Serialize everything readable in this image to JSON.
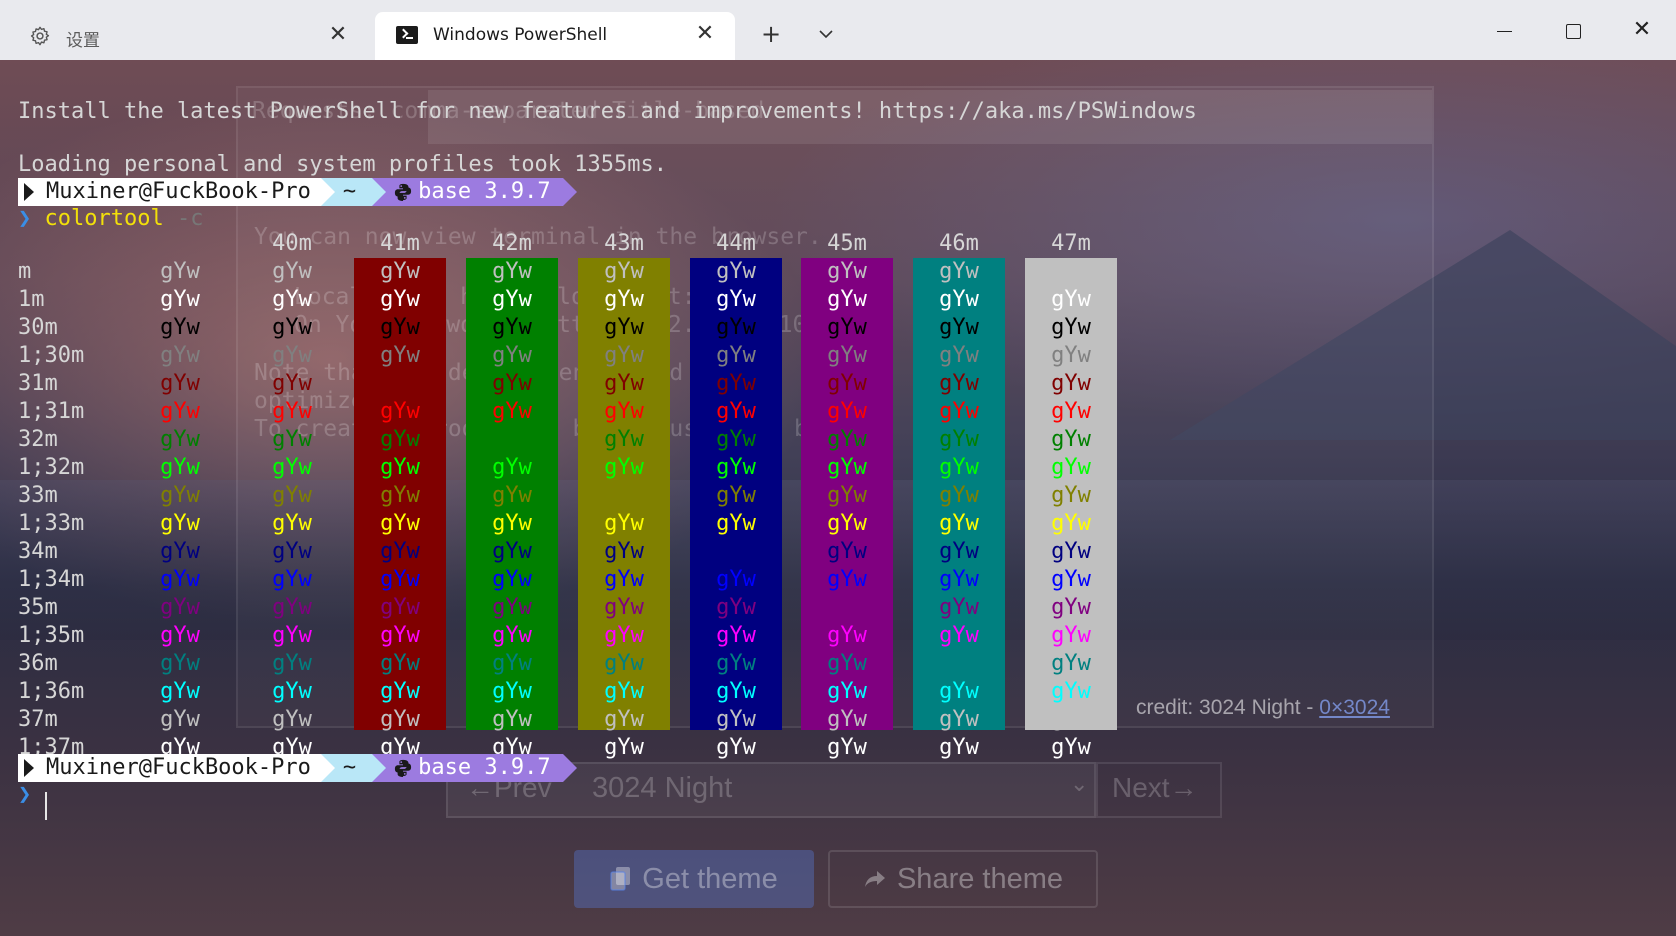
{
  "tabs": [
    {
      "label": "设置",
      "icon": "gear-icon"
    },
    {
      "label": "Windows PowerShell",
      "icon": "powershell-icon"
    }
  ],
  "tabbar": {
    "new_tab": "+",
    "dropdown": "⌄",
    "close": "✕"
  },
  "window": {
    "minimize": "minimize-icon",
    "maximize": "maximize-icon",
    "close": "✕"
  },
  "terminal": {
    "install_line": "Install the latest PowerShell for new features and improvements! https://aka.ms/PSWindows",
    "loading_line": "Loading personal and system profiles took 1355ms.",
    "prompt": {
      "user": "Muxiner@FuckBook-Pro",
      "dir": "~",
      "env": "base 3.9.7"
    },
    "prompt_char": "❯",
    "command": "colortool",
    "command_flag": "-c"
  },
  "colortool": {
    "bg_headers": [
      "40m",
      "41m",
      "42m",
      "43m",
      "44m",
      "45m",
      "46m",
      "47m"
    ],
    "bg_colors": [
      "",
      "#800000",
      "#008000",
      "#808000",
      "#000080",
      "#800080",
      "#008080",
      "#c0c0c0"
    ],
    "sample": "gYw",
    "rows": [
      {
        "label": "m",
        "color": "#c0c0c0"
      },
      {
        "label": "1m",
        "color": "#ffffff"
      },
      {
        "label": "30m",
        "color": "#000000"
      },
      {
        "label": "1;30m",
        "color": "#808080"
      },
      {
        "label": "31m",
        "color": "#800000"
      },
      {
        "label": "1;31m",
        "color": "#ff0000"
      },
      {
        "label": "32m",
        "color": "#008000"
      },
      {
        "label": "1;32m",
        "color": "#00ff00"
      },
      {
        "label": "33m",
        "color": "#808000"
      },
      {
        "label": "1;33m",
        "color": "#ffff00"
      },
      {
        "label": "34m",
        "color": "#000080"
      },
      {
        "label": "1;34m",
        "color": "#0000ff"
      },
      {
        "label": "35m",
        "color": "#800080"
      },
      {
        "label": "1;35m",
        "color": "#ff00ff"
      },
      {
        "label": "36m",
        "color": "#008080"
      },
      {
        "label": "1;36m",
        "color": "#00ffff"
      },
      {
        "label": "37m",
        "color": "#c0c0c0"
      },
      {
        "label": "1;37m",
        "color": "#ffffff"
      }
    ]
  },
  "background_page": {
    "banner": "Requests: comma-separated Title-based",
    "line1": "You can now view terminal in the browser.",
    "line2": "Local:      http://localhost:3000",
    "line3": "On Your Network:  http://192.168.0.10:3000",
    "line4": "Note that the development build is not",
    "line5": "optimized.",
    "line6": "To create a production build, use yarn build.",
    "prev": "←Prev",
    "theme_name": "3024 Night",
    "next": "Next→",
    "credit_prefix": "credit: 3024 Night - ",
    "credit_link": "0×3024",
    "get_theme": "Get theme",
    "share_theme": "Share theme"
  }
}
